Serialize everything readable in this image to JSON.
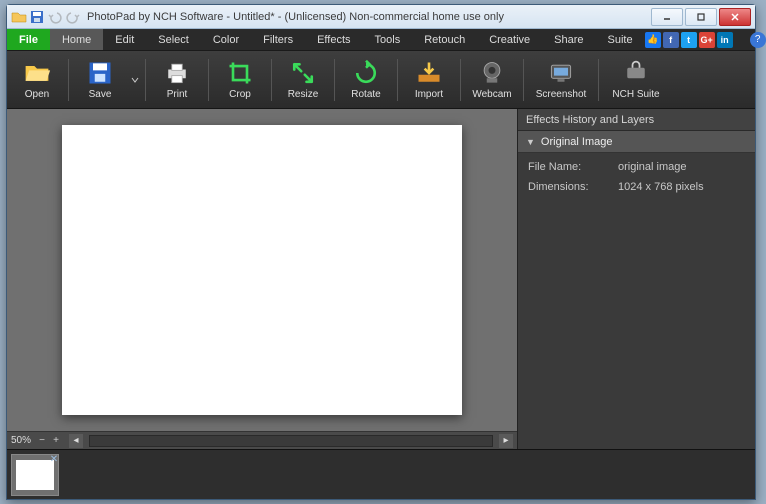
{
  "window": {
    "title": "PhotoPad by NCH Software - Untitled* - (Unlicensed) Non-commercial home use only"
  },
  "menu": {
    "file": "File",
    "items": [
      "Home",
      "Edit",
      "Select",
      "Color",
      "Filters",
      "Effects",
      "Tools",
      "Retouch",
      "Creative",
      "Share",
      "Suite"
    ]
  },
  "ribbon": {
    "open": "Open",
    "save": "Save",
    "print": "Print",
    "crop": "Crop",
    "resize": "Resize",
    "rotate": "Rotate",
    "import": "Import",
    "webcam": "Webcam",
    "screenshot": "Screenshot",
    "suite": "NCH Suite"
  },
  "panel": {
    "title": "Effects History and Layers",
    "row_label": "Original Image",
    "filename_label": "File Name:",
    "filename_value": "original image",
    "dims_label": "Dimensions:",
    "dims_value": "1024 x 768 pixels"
  },
  "status": {
    "zoom": "50%"
  }
}
